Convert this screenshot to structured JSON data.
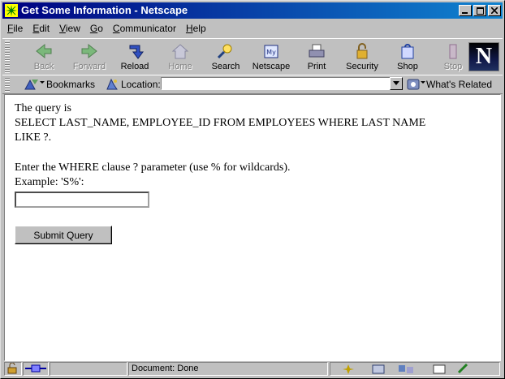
{
  "window": {
    "title": "Get Some Information - Netscape"
  },
  "menubar": {
    "items": [
      "File",
      "Edit",
      "View",
      "Go",
      "Communicator",
      "Help"
    ],
    "accel": [
      "F",
      "E",
      "V",
      "G",
      "C",
      "H"
    ]
  },
  "toolbar": {
    "buttons": [
      {
        "label": "Back",
        "icon": "back-arrow-icon",
        "enabled": false
      },
      {
        "label": "Forward",
        "icon": "forward-arrow-icon",
        "enabled": false
      },
      {
        "label": "Reload",
        "icon": "reload-icon",
        "enabled": true
      },
      {
        "label": "Home",
        "icon": "home-icon",
        "enabled": false
      },
      {
        "label": "Search",
        "icon": "search-icon",
        "enabled": true
      },
      {
        "label": "Netscape",
        "icon": "netscape-my-icon",
        "enabled": true
      },
      {
        "label": "Print",
        "icon": "printer-icon",
        "enabled": true
      },
      {
        "label": "Security",
        "icon": "lock-icon",
        "enabled": true
      },
      {
        "label": "Shop",
        "icon": "shop-icon",
        "enabled": true
      },
      {
        "label": "Stop",
        "icon": "stop-icon",
        "enabled": false
      }
    ],
    "logo_letter": "N"
  },
  "location": {
    "bookmarks_label": "Bookmarks",
    "location_label": "Location:",
    "url": "",
    "related_label": "What's Related"
  },
  "page": {
    "line1": "The query is",
    "line2": "SELECT LAST_NAME, EMPLOYEE_ID FROM EMPLOYEES WHERE LAST NAME",
    "line3": "LIKE ?.",
    "line4": "Enter the WHERE clause ? parameter (use % for wildcards).",
    "line5": "Example: 'S%':",
    "input_value": "",
    "submit_label": "Submit Query"
  },
  "status": {
    "text": "Document: Done"
  },
  "colors": {
    "titlebar": "#000080",
    "chrome": "#c0c0c0"
  }
}
